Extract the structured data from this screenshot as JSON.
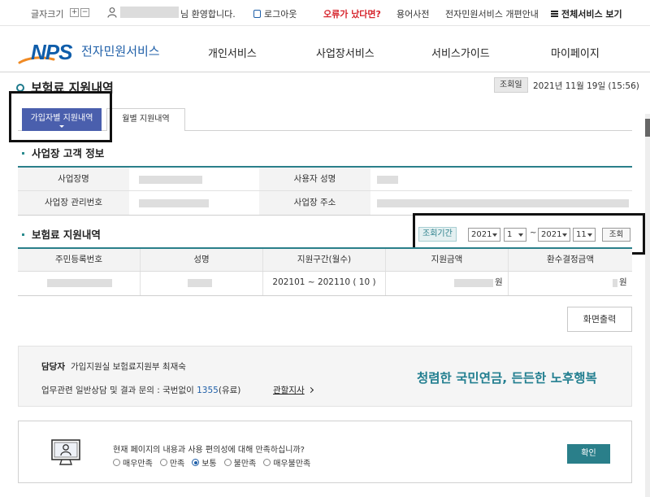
{
  "topbar": {
    "font_size_label": "글자크기",
    "font_plus": "+",
    "font_minus": "−",
    "welcome": "님 환영합니다.",
    "logout": "로그아웃",
    "error_report": "오류가 났다면?",
    "dictionary": "용어사전",
    "renewal_notice": "전자민원서비스 개편안내",
    "all_services": "전체서비스 보기"
  },
  "logo": {
    "mark": "NPS",
    "text": "전자민원서비스"
  },
  "nav": [
    "개인서비스",
    "사업장서비스",
    "서비스가이드",
    "마이페이지"
  ],
  "page": {
    "title": "보험료 지원내역",
    "query_date_label": "조회일",
    "query_date": "2021년 11월 19일 (15:56)"
  },
  "tabs": [
    {
      "label": "가입자별 지원내역",
      "active": true
    },
    {
      "label": "월별 지원내역",
      "active": false
    }
  ],
  "customer_info": {
    "section_title": "사업장 고객 정보",
    "business_name_label": "사업장명",
    "user_name_label": "사용자 성명",
    "mgmt_no_label": "사업장 관리번호",
    "address_label": "사업장 주소"
  },
  "support": {
    "section_title": "보험료 지원내역",
    "period_label": "조회기간",
    "from_year": "2021",
    "from_month": "1",
    "tilde": "~",
    "to_year": "2021",
    "to_month": "11",
    "search_button": "조회",
    "columns": [
      "주민등록번호",
      "성명",
      "지원구간(월수)",
      "지원금액",
      "환수결정금액"
    ],
    "row": {
      "period": "202101 ~ 202110 ( 10 )",
      "amount_unit": "원",
      "refund_unit": "원"
    }
  },
  "print_button": "화면출력",
  "contact": {
    "label": "담당자",
    "dept": "가입지원실 보험료지원부 최재숙",
    "inquiry_prefix": "업무관련 일반상담 및 결과 문의 : 국번없이 ",
    "inquiry_number": "1355",
    "inquiry_suffix": "(유료)",
    "branch_link": "관할지사",
    "slogan": "청렴한 국민연금, 든든한 노후행복"
  },
  "survey": {
    "question": "현재 페이지의 내용과 사용 편의성에 대해 만족하십니까?",
    "options": [
      "매우만족",
      "만족",
      "보통",
      "불만족",
      "매우불만족"
    ],
    "selected": "보통",
    "confirm": "확인"
  },
  "colors": {
    "primary": "#4a5fad",
    "teal": "#2a7f8a",
    "error": "#d7262e",
    "link": "#1f5fa8"
  }
}
